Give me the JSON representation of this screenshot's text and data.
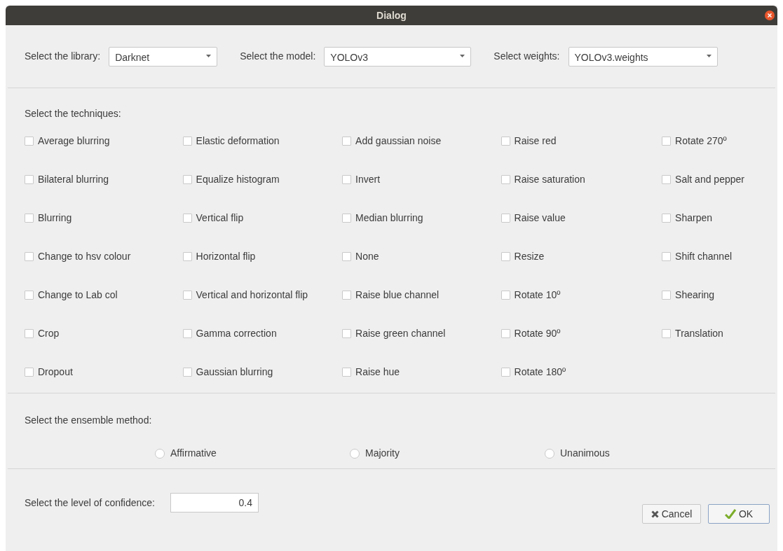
{
  "window": {
    "title": "Dialog"
  },
  "selectors": [
    {
      "label": "Select the library:",
      "value": "Darknet"
    },
    {
      "label": "Select the model:",
      "value": "YOLOv3"
    },
    {
      "label": "Select weights:",
      "value": "YOLOv3.weights"
    }
  ],
  "techniques": {
    "label": "Select the techniques:",
    "columns": [
      [
        {
          "label": "Average blurring",
          "checked": false
        },
        {
          "label": "Bilateral blurring",
          "checked": false
        },
        {
          "label": "Blurring",
          "checked": false
        },
        {
          "label": "Change to hsv colour",
          "checked": false
        },
        {
          "label": "Change to Lab col",
          "checked": false
        },
        {
          "label": "Crop",
          "checked": false
        },
        {
          "label": "Dropout",
          "checked": false
        }
      ],
      [
        {
          "label": "Elastic deformation",
          "checked": false
        },
        {
          "label": "Equalize histogram",
          "checked": false
        },
        {
          "label": "Vertical flip",
          "checked": false
        },
        {
          "label": "Horizontal flip",
          "checked": false
        },
        {
          "label": "Vertical and horizontal flip",
          "checked": false
        },
        {
          "label": "Gamma correction",
          "checked": false
        },
        {
          "label": "Gaussian blurring",
          "checked": false
        }
      ],
      [
        {
          "label": "Add gaussian noise",
          "checked": false
        },
        {
          "label": "Invert",
          "checked": false
        },
        {
          "label": "Median blurring",
          "checked": false
        },
        {
          "label": "None",
          "checked": false
        },
        {
          "label": "Raise blue channel",
          "checked": false
        },
        {
          "label": "Raise green channel",
          "checked": false
        },
        {
          "label": "Raise hue",
          "checked": false
        }
      ],
      [
        {
          "label": "Raise red",
          "checked": false
        },
        {
          "label": "Raise saturation",
          "checked": false
        },
        {
          "label": "Raise value",
          "checked": false
        },
        {
          "label": "Resize",
          "checked": false
        },
        {
          "label": "Rotate 10º",
          "checked": false
        },
        {
          "label": "Rotate 90º",
          "checked": false
        },
        {
          "label": "Rotate 180º",
          "checked": false
        }
      ],
      [
        {
          "label": "Rotate 270º",
          "checked": false
        },
        {
          "label": "Salt and pepper",
          "checked": false
        },
        {
          "label": "Sharpen",
          "checked": false
        },
        {
          "label": "Shift channel",
          "checked": false
        },
        {
          "label": "Shearing",
          "checked": false
        },
        {
          "label": "Translation",
          "checked": false
        }
      ]
    ]
  },
  "ensemble": {
    "label": "Select the ensemble method:",
    "options": [
      {
        "label": "Affirmative",
        "selected": false
      },
      {
        "label": "Majority",
        "selected": false
      },
      {
        "label": "Unanimous",
        "selected": false
      }
    ]
  },
  "confidence": {
    "label": "Select the level of confidence:",
    "value": "0.4"
  },
  "buttons": [
    {
      "kind": "cancel",
      "label": "Cancel"
    },
    {
      "kind": "ok",
      "label": "OK"
    }
  ]
}
